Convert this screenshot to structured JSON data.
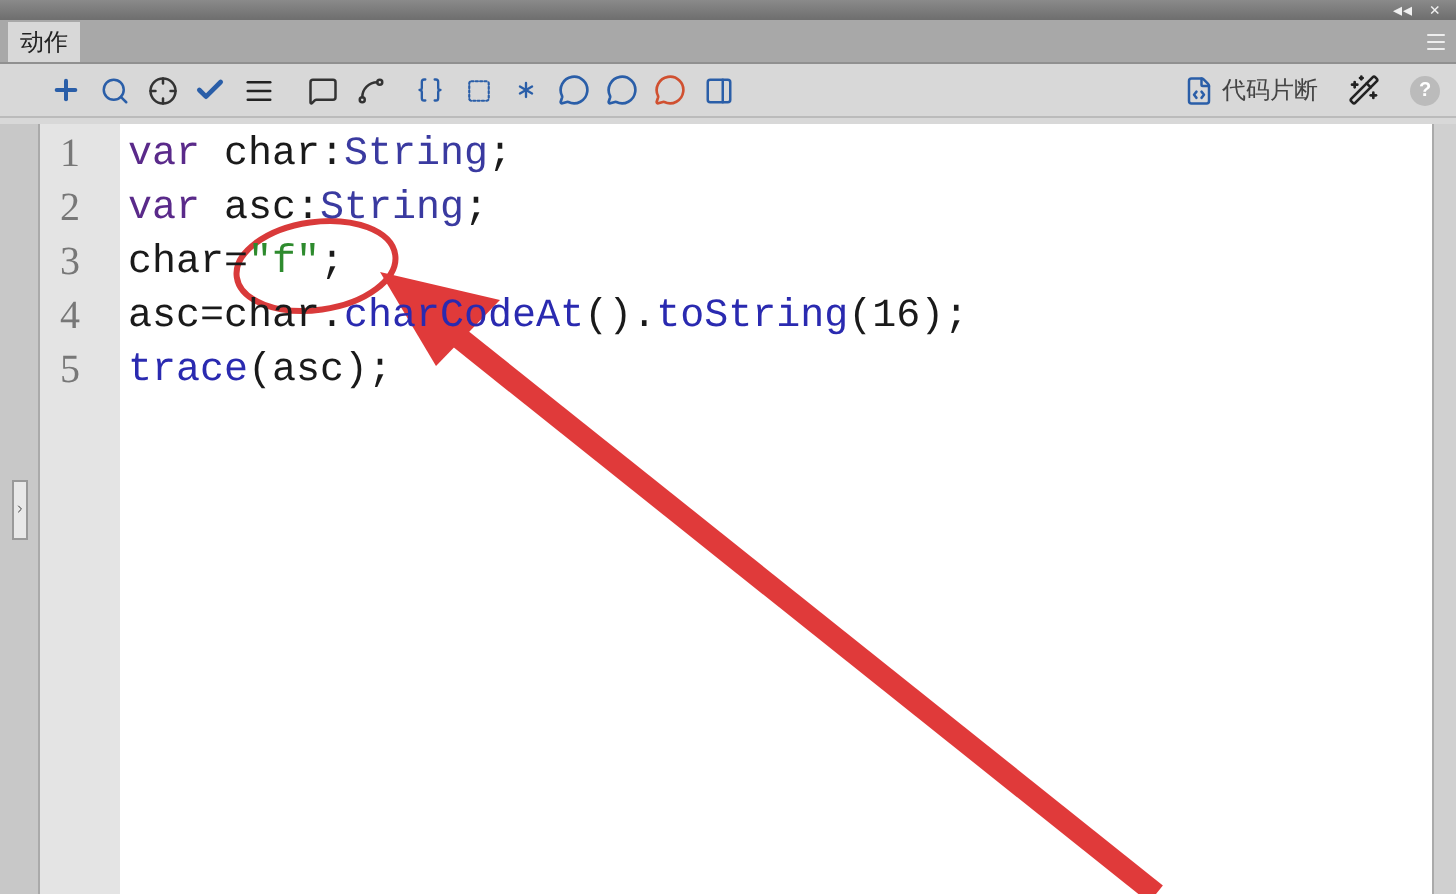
{
  "window": {
    "title_controls": [
      "◂◂",
      "×"
    ]
  },
  "tabs": [
    {
      "label": "动作",
      "selected": true
    }
  ],
  "toolbar": {
    "snippets_label": "代码片断",
    "help_label": "?"
  },
  "code": {
    "lines": [
      {
        "number": "1",
        "tokens": [
          {
            "kind": "keyword",
            "text": "var"
          },
          {
            "kind": "plain",
            "text": " char:"
          },
          {
            "kind": "type",
            "text": "String"
          },
          {
            "kind": "plain",
            "text": ";"
          }
        ]
      },
      {
        "number": "2",
        "tokens": [
          {
            "kind": "keyword",
            "text": "var"
          },
          {
            "kind": "plain",
            "text": " asc:"
          },
          {
            "kind": "type",
            "text": "String"
          },
          {
            "kind": "plain",
            "text": ";"
          }
        ]
      },
      {
        "number": "3",
        "tokens": [
          {
            "kind": "plain",
            "text": "char="
          },
          {
            "kind": "string",
            "text": "\"f\""
          },
          {
            "kind": "plain",
            "text": ";"
          }
        ]
      },
      {
        "number": "4",
        "tokens": [
          {
            "kind": "plain",
            "text": "asc=char."
          },
          {
            "kind": "builtin",
            "text": "charCodeAt"
          },
          {
            "kind": "plain",
            "text": "()."
          },
          {
            "kind": "builtin",
            "text": "toString"
          },
          {
            "kind": "plain",
            "text": "(16);"
          }
        ]
      },
      {
        "number": "5",
        "tokens": [
          {
            "kind": "builtin",
            "text": "trace"
          },
          {
            "kind": "plain",
            "text": "(asc);"
          }
        ]
      }
    ]
  }
}
